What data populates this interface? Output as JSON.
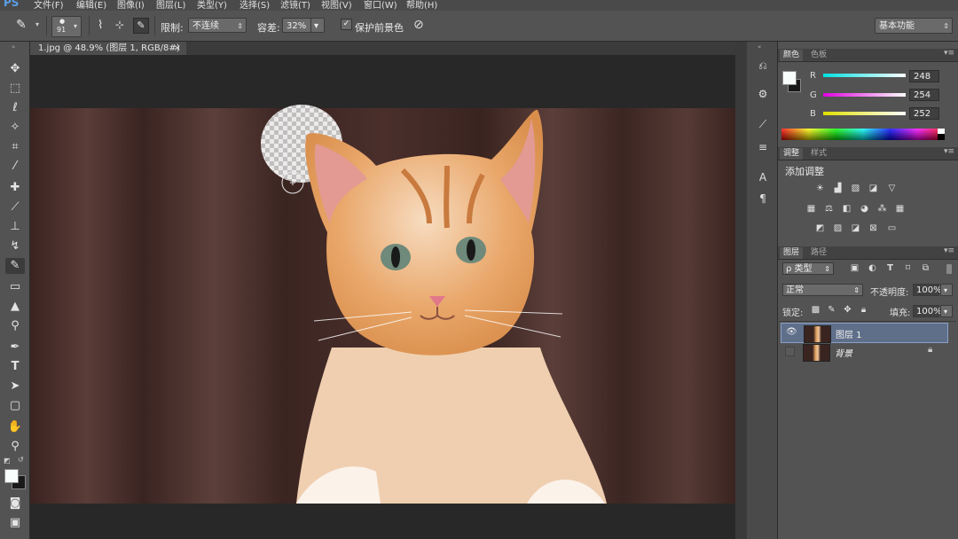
{
  "app": {
    "logo": "PS"
  },
  "menu": [
    "文件(F)",
    "编辑(E)",
    "图像(I)",
    "图层(L)",
    "类型(Y)",
    "选择(S)",
    "滤镜(T)",
    "视图(V)",
    "窗口(W)",
    "帮助(H)"
  ],
  "options_bar": {
    "brush_size": "91",
    "limit_label": "限制:",
    "limit_value": "不连续",
    "tolerance_label": "容差:",
    "tolerance_value": "32%",
    "protect_fg_label": "保护前景色",
    "workspace": "基本功能"
  },
  "document_tab": {
    "title": "1.jpg @ 48.9% (图层 1, RGB/8#) *",
    "close": "×"
  },
  "color_panel": {
    "tabs": [
      "颜色",
      "色板"
    ],
    "channels": [
      {
        "label": "R",
        "value": "248",
        "color": "#00e0e0"
      },
      {
        "label": "G",
        "value": "254",
        "color": "#e000e0"
      },
      {
        "label": "B",
        "value": "252",
        "color": "#e0e000"
      }
    ],
    "foreground": "#f8fefc"
  },
  "adjustments_panel": {
    "tabs": [
      "调整",
      "样式"
    ],
    "title": "添加调整"
  },
  "layers_panel": {
    "tabs": [
      "图层",
      "路径"
    ],
    "kind_filter": "ρ 类型",
    "blend_mode": "正常",
    "opacity_label": "不透明度:",
    "opacity_value": "100%",
    "lock_label": "锁定:",
    "fill_label": "填充:",
    "fill_value": "100%",
    "layers": [
      {
        "name": "图层 1",
        "visible": true,
        "selected": true,
        "locked": false
      },
      {
        "name": "背景",
        "visible": false,
        "selected": false,
        "locked": true
      }
    ]
  }
}
